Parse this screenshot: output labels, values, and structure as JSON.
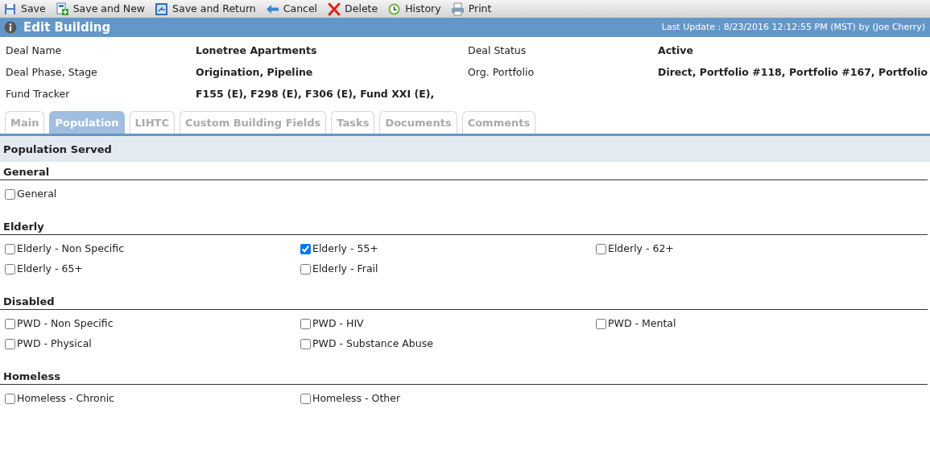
{
  "toolbar": [
    {
      "kind": "save",
      "label": "Save"
    },
    {
      "kind": "save_new",
      "label": "Save and New"
    },
    {
      "kind": "save_return",
      "label": "Save and Return"
    },
    {
      "kind": "cancel",
      "label": "Cancel"
    },
    {
      "kind": "delete",
      "label": "Delete"
    },
    {
      "kind": "history",
      "label": "History"
    },
    {
      "kind": "print",
      "label": "Print"
    }
  ],
  "header": {
    "title": "Edit Building",
    "last_update": "Last Update : 8/23/2016 12:12:55 PM (MST) by (Joe Cherry)"
  },
  "fields": [
    [
      {
        "label": "Deal Name",
        "value": "Lonetree Apartments"
      },
      {
        "label": "Deal Status",
        "value": "Active"
      }
    ],
    [
      {
        "label": "Deal Phase, Stage",
        "value": "Origination, Pipeline"
      },
      {
        "label": "Org. Portfolio",
        "value": "Direct, Portfolio #118, Portfolio #167, Portfolio"
      }
    ],
    [
      {
        "label": "Fund Tracker",
        "value": "F155 (E), F298 (E), F306 (E), Fund XXI (E),"
      }
    ]
  ],
  "tabs": [
    {
      "label": "Main",
      "selected": false
    },
    {
      "label": "Population",
      "selected": true
    },
    {
      "label": "LIHTC",
      "selected": false
    },
    {
      "label": "Custom Building Fields",
      "selected": false
    },
    {
      "label": "Tasks",
      "selected": false
    },
    {
      "label": "Documents",
      "selected": false
    },
    {
      "label": "Comments",
      "selected": false
    }
  ],
  "section_title": "Population Served",
  "groups": [
    {
      "title": "General",
      "items": [
        {
          "label": "General",
          "checked": false
        }
      ]
    },
    {
      "title": "Elderly",
      "items": [
        {
          "label": "Elderly - Non Specific",
          "checked": false
        },
        {
          "label": "Elderly - 55+",
          "checked": true
        },
        {
          "label": "Elderly - 62+",
          "checked": false
        },
        {
          "label": "Elderly - 65+",
          "checked": false
        },
        {
          "label": "Elderly - Frail",
          "checked": false
        }
      ]
    },
    {
      "title": "Disabled",
      "items": [
        {
          "label": "PWD - Non Specific",
          "checked": false
        },
        {
          "label": "PWD - HIV",
          "checked": false
        },
        {
          "label": "PWD - Mental",
          "checked": false
        },
        {
          "label": "PWD - Physical",
          "checked": false
        },
        {
          "label": "PWD - Substance Abuse",
          "checked": false
        }
      ]
    },
    {
      "title": "Homeless",
      "items": [
        {
          "label": "Homeless - Chronic",
          "checked": false
        },
        {
          "label": "Homeless - Other",
          "checked": false
        }
      ]
    }
  ]
}
